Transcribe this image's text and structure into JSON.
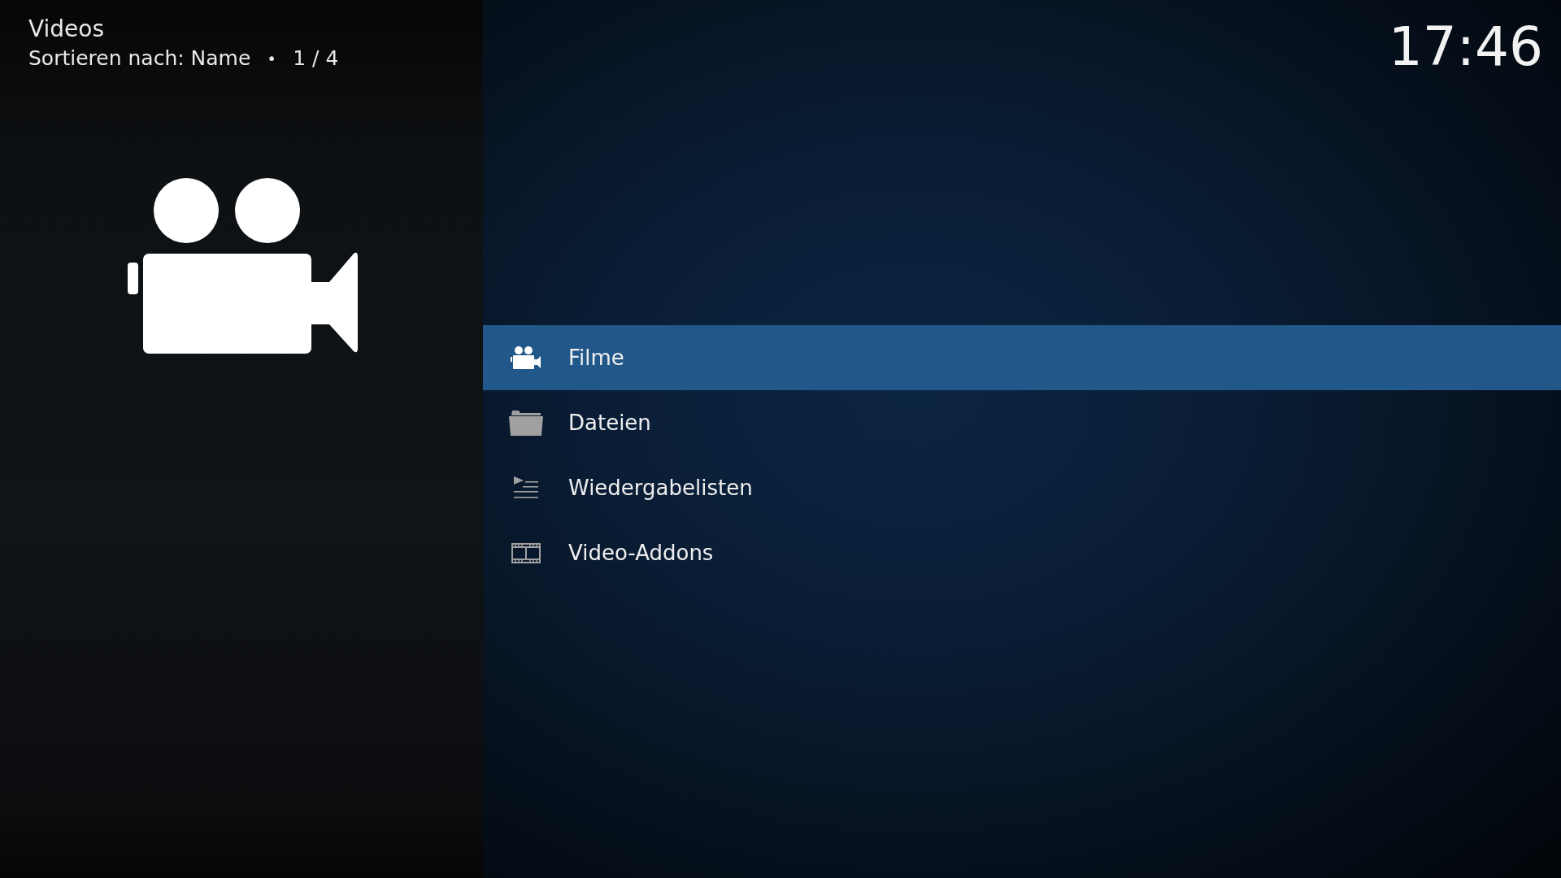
{
  "header": {
    "title": "Videos",
    "sort_label": "Sortieren nach: Name",
    "separator": "•",
    "position": "1 / 4"
  },
  "clock": "17:46",
  "menu": [
    {
      "label": "Filme",
      "selected": true
    },
    {
      "label": "Dateien",
      "selected": false
    },
    {
      "label": "Wiedergabelisten",
      "selected": false
    },
    {
      "label": "Video-Addons",
      "selected": false
    }
  ]
}
